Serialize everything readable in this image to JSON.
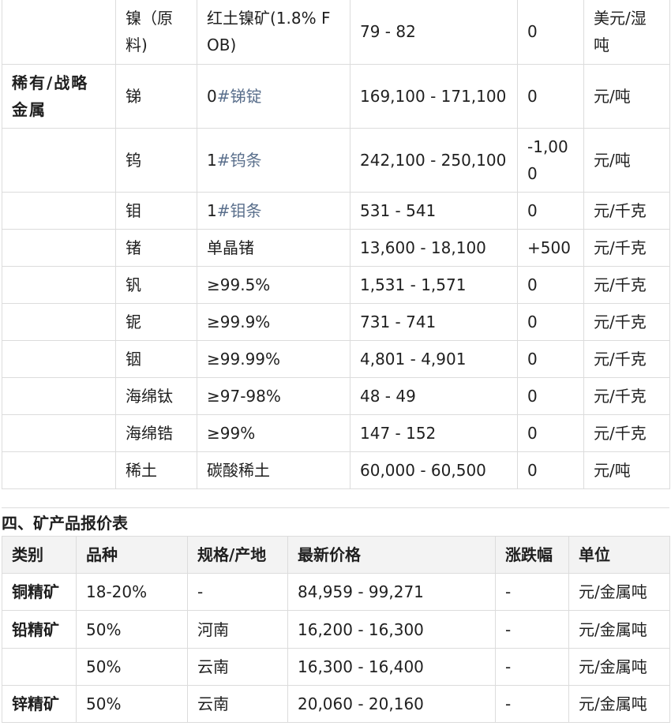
{
  "metals_table": {
    "rows": [
      {
        "category": "",
        "name": "镍（原料)",
        "spec": "红土镍矿(1.8% FOB)",
        "price": "79 - 82",
        "change": "0",
        "unit": "美元/湿吨",
        "spec_link": false
      },
      {
        "category": "稀有/战略金属",
        "name": "锑",
        "spec_prefix": "0",
        "spec_suffix": "#锑锭",
        "price": "169,100 - 171,100",
        "change": "0",
        "unit": "元/吨",
        "spec_link": true
      },
      {
        "category": "",
        "name": "钨",
        "spec_prefix": "1",
        "spec_suffix": "#钨条",
        "price": "242,100 - 250,100",
        "change": "-1,000",
        "unit": "元/吨",
        "spec_link": true
      },
      {
        "category": "",
        "name": "钼",
        "spec_prefix": "1",
        "spec_suffix": "#钼条",
        "price": "531 - 541",
        "change": "0",
        "unit": "元/千克",
        "spec_link": true
      },
      {
        "category": "",
        "name": "锗",
        "spec": "单晶锗",
        "price": "13,600 - 18,100",
        "change": "+500",
        "unit": "元/千克",
        "spec_link": false
      },
      {
        "category": "",
        "name": "钒",
        "spec": "≥99.5%",
        "price": "1,531 - 1,571",
        "change": "0",
        "unit": "元/千克",
        "spec_link": false
      },
      {
        "category": "",
        "name": "铌",
        "spec": "≥99.9%",
        "price": "731 - 741",
        "change": "0",
        "unit": "元/千克",
        "spec_link": false
      },
      {
        "category": "",
        "name": "铟",
        "spec": "≥99.99%",
        "price": "4,801 - 4,901",
        "change": "0",
        "unit": "元/千克",
        "spec_link": false
      },
      {
        "category": "",
        "name": "海绵钛",
        "spec": "≥97-98%",
        "price": "48 - 49",
        "change": "0",
        "unit": "元/千克",
        "spec_link": false
      },
      {
        "category": "",
        "name": "海绵锆",
        "spec": "≥99%",
        "price": "147 - 152",
        "change": "0",
        "unit": "元/千克",
        "spec_link": false
      },
      {
        "category": "",
        "name": "稀土",
        "spec": "碳酸稀土",
        "price": "60,000 - 60,500",
        "change": "0",
        "unit": "元/吨",
        "spec_link": false
      }
    ]
  },
  "section_title": "四、矿产品报价表",
  "ore_table": {
    "headers": [
      "类别",
      "品种",
      "规格/产地",
      "最新价格",
      "涨跌幅",
      "单位"
    ],
    "rows": [
      {
        "category": "铜精矿",
        "grade": "18-20%",
        "origin": "-",
        "price": "84,959 - 99,271",
        "change": "-",
        "unit": "元/金属吨"
      },
      {
        "category": "铅精矿",
        "grade": "50%",
        "origin": "河南",
        "price": "16,200 - 16,300",
        "change": "-",
        "unit": "元/金属吨"
      },
      {
        "category": "",
        "grade": "50%",
        "origin": "云南",
        "price": "16,300 - 16,400",
        "change": "-",
        "unit": "元/金属吨"
      },
      {
        "category": "锌精矿",
        "grade": "50%",
        "origin": "云南",
        "price": "20,060 - 20,160",
        "change": "-",
        "unit": "元/金属吨"
      }
    ]
  }
}
